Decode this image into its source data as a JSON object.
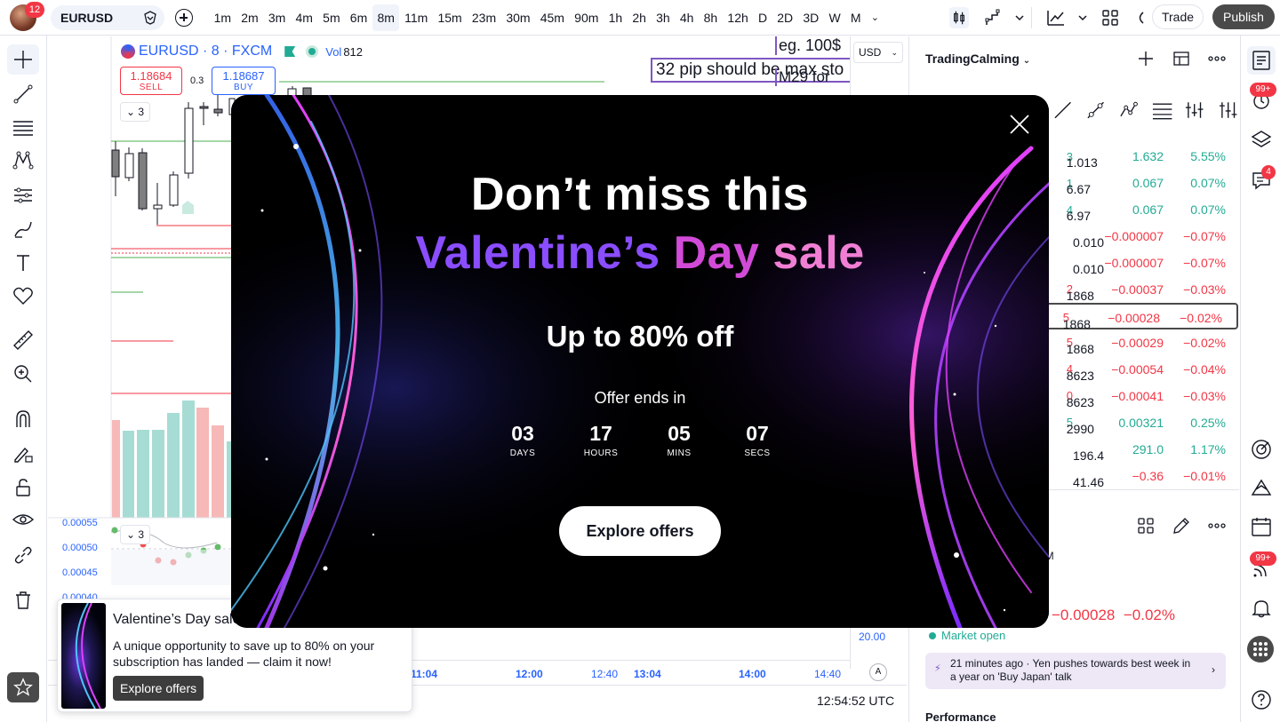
{
  "topbar": {
    "notifications_count": "12",
    "symbol": "EURUSD",
    "intervals": [
      "1m",
      "2m",
      "3m",
      "4m",
      "5m",
      "6m",
      "8m",
      "11m",
      "15m",
      "23m",
      "30m",
      "45m",
      "90m",
      "1h",
      "2h",
      "3h",
      "4h",
      "8h",
      "12h",
      "D",
      "2D",
      "3D",
      "W",
      "M"
    ],
    "active_interval": "8m",
    "trade_label": "Trade",
    "publish_label": "Publish"
  },
  "chart": {
    "legend_symbol": "EURUSD · 8 · FXCM",
    "vol_label": "Vol",
    "vol_value": "812",
    "sell_price": "1.18684",
    "sell_label": "SELL",
    "buy_price": "1.18687",
    "buy_label": "BUY",
    "spread": "0.3",
    "collapse_count": "3",
    "indicator_collapse_count": "3",
    "note_main": "32 pip should be max sto",
    "note_top": "eg. 100$",
    "note_bottom": "M29 for",
    "currency": "USD",
    "axis_value": "20.00",
    "indicator_axis": [
      "0.00055",
      "0.00050",
      "0.00045",
      "0.00040"
    ],
    "time_labels": [
      {
        "text": "11:04",
        "bold": true
      },
      {
        "text": "12:00",
        "bold": true
      },
      {
        "text": "12:40",
        "bold": false
      },
      {
        "text": "13:04",
        "bold": true
      },
      {
        "text": "14:00",
        "bold": true
      },
      {
        "text": "14:40",
        "bold": false
      }
    ],
    "auto_label": "A",
    "utc_time": "12:54:52 UTC"
  },
  "watchlist": {
    "title": "TradingCalming",
    "rows": [
      {
        "last": "1.013",
        "tick": "3",
        "chg": "1.632",
        "pct": "5.55%",
        "dir": "up"
      },
      {
        "last": "6.67",
        "tick": "1",
        "chg": "0.067",
        "pct": "0.07%",
        "dir": "up"
      },
      {
        "last": "6.97",
        "tick": "4",
        "chg": "0.067",
        "pct": "0.07%",
        "dir": "up"
      },
      {
        "last": "0.010",
        "tick": "",
        "chg": "−0.000007",
        "pct": "−0.07%",
        "dir": "down"
      },
      {
        "last": "0.010",
        "tick": "",
        "chg": "−0.000007",
        "pct": "−0.07%",
        "dir": "down"
      },
      {
        "last": "1868",
        "tick": "2",
        "chg": "−0.00037",
        "pct": "−0.03%",
        "dir": "down"
      },
      {
        "last": "1868",
        "tick": "5",
        "chg": "−0.00028",
        "pct": "−0.02%",
        "dir": "down"
      },
      {
        "last": "1868",
        "tick": "5",
        "chg": "−0.00029",
        "pct": "−0.02%",
        "dir": "down"
      },
      {
        "last": "8623",
        "tick": "4",
        "chg": "−0.00054",
        "pct": "−0.04%",
        "dir": "down"
      },
      {
        "last": "8623",
        "tick": "0",
        "chg": "−0.00041",
        "pct": "−0.03%",
        "dir": "down"
      },
      {
        "last": "2990",
        "tick": "5",
        "chg": "0.00321",
        "pct": "0.25%",
        "dir": "up"
      },
      {
        "last": "196.4",
        "tick": "",
        "chg": "291.0",
        "pct": "1.17%",
        "dir": "up"
      },
      {
        "last": "41.46",
        "tick": "",
        "chg": "−0.36",
        "pct": "−0.01%",
        "dir": "down"
      }
    ],
    "selected_row": 6
  },
  "details": {
    "exchange": "XCM",
    "change": "−0.00028",
    "change_pct": "−0.02%",
    "market_status": "Market open",
    "news_time": "21 minutes ago",
    "news_headline": "Yen pushes towards best week in a year on 'Buy Japan' talk",
    "performance_title": "Performance"
  },
  "rightbar": {
    "badge_alerts": "99+",
    "badge_chat": "4",
    "badge_feed": "99+"
  },
  "toast": {
    "title": "Valentine’s Day sale",
    "text": "A unique opportunity to save up to 80% on your subscription has landed — claim it now!",
    "button": "Explore offers"
  },
  "modal": {
    "headline_1": "Don’t miss this",
    "headline_2a": "Valentine’s",
    "headline_2b": "Day",
    "headline_2c": "sale",
    "subheadline": "Up to 80% off",
    "offer_ends": "Offer ends in",
    "countdown": [
      {
        "value": "03",
        "unit": "DAYS"
      },
      {
        "value": "17",
        "unit": "HOURS"
      },
      {
        "value": "05",
        "unit": "MINS"
      },
      {
        "value": "07",
        "unit": "SECS"
      }
    ],
    "cta": "Explore offers"
  },
  "colors": {
    "up": "#22ab94",
    "down": "#f23645",
    "accent": "#2962ff",
    "dark": "#4a4a4a"
  }
}
